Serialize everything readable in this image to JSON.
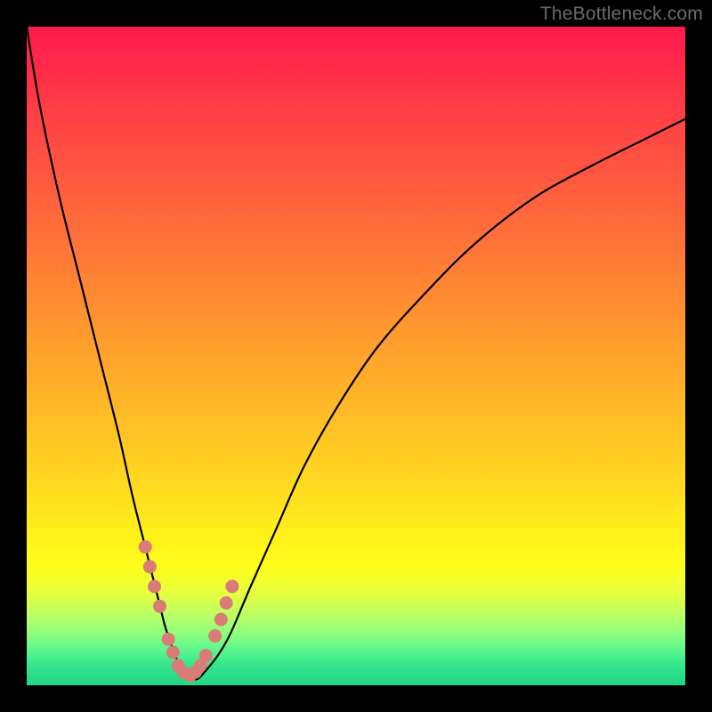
{
  "watermark": {
    "text": "TheBottleneck.com"
  },
  "chart_data": {
    "type": "line",
    "title": "",
    "xlabel": "",
    "ylabel": "",
    "xlim": [
      0,
      100
    ],
    "ylim": [
      0,
      100
    ],
    "grid": false,
    "legend": false,
    "series": [
      {
        "name": "bottleneck-curve",
        "x": [
          0,
          2,
          5,
          8,
          11,
          14,
          16,
          18,
          20,
          21,
          22,
          23,
          24,
          25,
          26,
          27,
          29,
          31,
          34,
          38,
          42,
          47,
          53,
          60,
          68,
          77,
          86,
          94,
          100
        ],
        "y": [
          100,
          88,
          74,
          62,
          50,
          38,
          29,
          21,
          13,
          9,
          6,
          3.5,
          2,
          1,
          1,
          2,
          4.5,
          8,
          15,
          24,
          33,
          42,
          51,
          59,
          67,
          74,
          79,
          83,
          86
        ]
      },
      {
        "name": "highlight-dots",
        "x": [
          18,
          18.7,
          19.4,
          20.2,
          21.5,
          22.2,
          23,
          23.8,
          24.8,
          25.6,
          26.4,
          27.2,
          28.6,
          29.5,
          30.3,
          31.2
        ],
        "y": [
          21,
          18,
          15,
          12,
          7,
          5,
          3,
          2,
          1.5,
          2,
          3,
          4.5,
          7.5,
          10,
          12.5,
          15
        ]
      }
    ],
    "colors": {
      "curve": "#000000",
      "dots": "#d97b76",
      "background_top": "#ff1a4d",
      "background_bottom": "#22d688"
    }
  }
}
